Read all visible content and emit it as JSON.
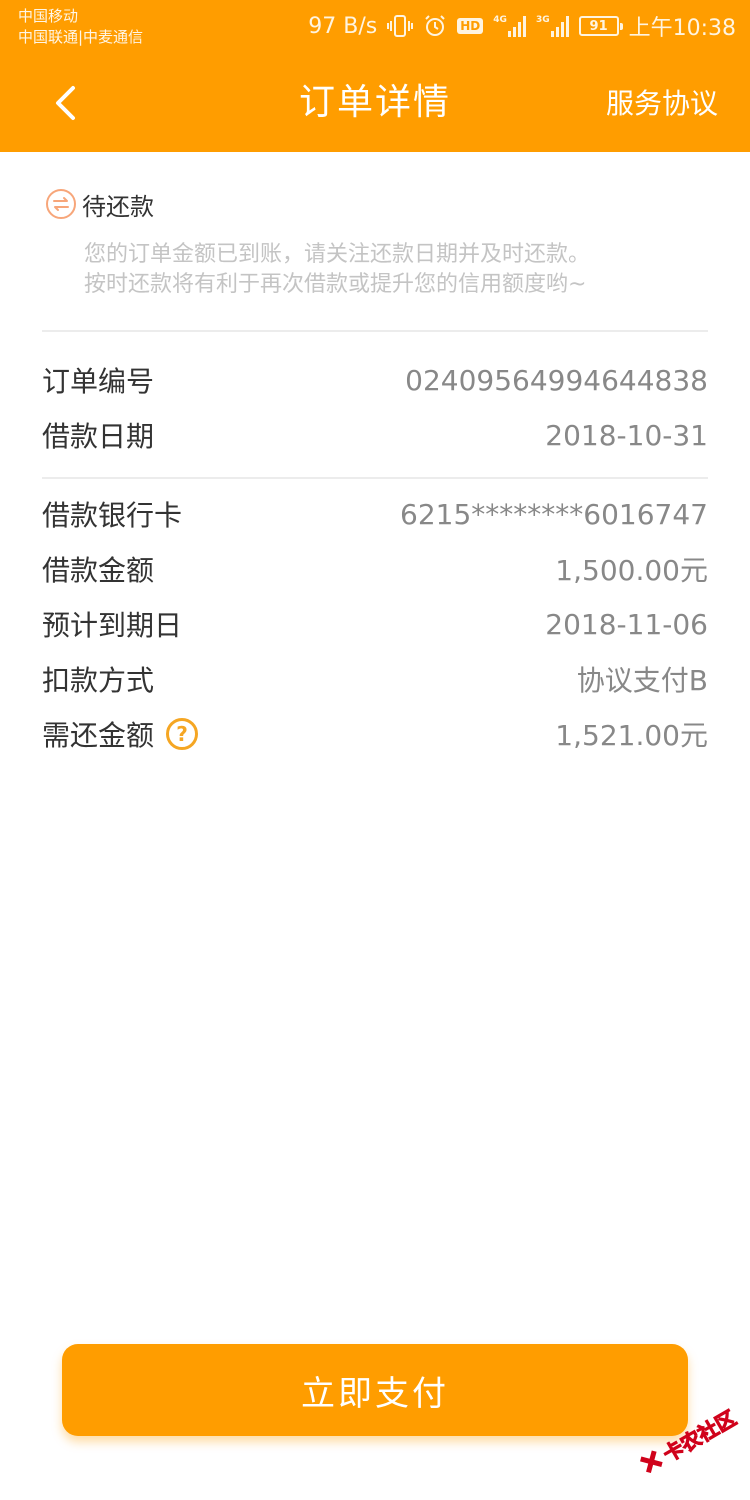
{
  "status_bar": {
    "carrier_1": "中国移动",
    "carrier_2": "中国联通|中麦通信",
    "network_speed": "97 B/s",
    "net_4g": "4G",
    "net_3g": "3G",
    "hd": "HD",
    "battery": "91",
    "time": "上午10:38",
    "icons": [
      "vibrate-icon",
      "alarm-icon",
      "signal-icon",
      "battery-icon"
    ]
  },
  "header": {
    "title": "订单详情",
    "right_link": "服务协议",
    "back_icon": "chevron-left-icon"
  },
  "order_status": {
    "label": "待还款",
    "notice_line_1": "您的订单金额已到账，请关注还款日期并及时还款。",
    "notice_line_2": "按时还款将有利于再次借款或提升您的信用额度哟~"
  },
  "details": {
    "order_no": {
      "label": "订单编号",
      "value": "02409564994644838"
    },
    "loan_date": {
      "label": "借款日期",
      "value": "2018-10-31"
    },
    "bank_card": {
      "label": "借款银行卡",
      "value": "6215********6016747"
    },
    "loan_amount": {
      "label": "借款金额",
      "value": "1,500.00元"
    },
    "due_date": {
      "label": "预计到期日",
      "value": "2018-11-06"
    },
    "deduct_method": {
      "label": "扣款方式",
      "value": "协议支付B"
    },
    "repay_amount": {
      "label": "需还金额",
      "value": "1,521.00元",
      "help": "?"
    }
  },
  "pay_button": {
    "label": "立即支付"
  },
  "watermark": {
    "text": "卡农社区"
  },
  "colors": {
    "brand": "#ff9d00",
    "help": "#f5a623",
    "status_icon": "#f7a67a"
  }
}
